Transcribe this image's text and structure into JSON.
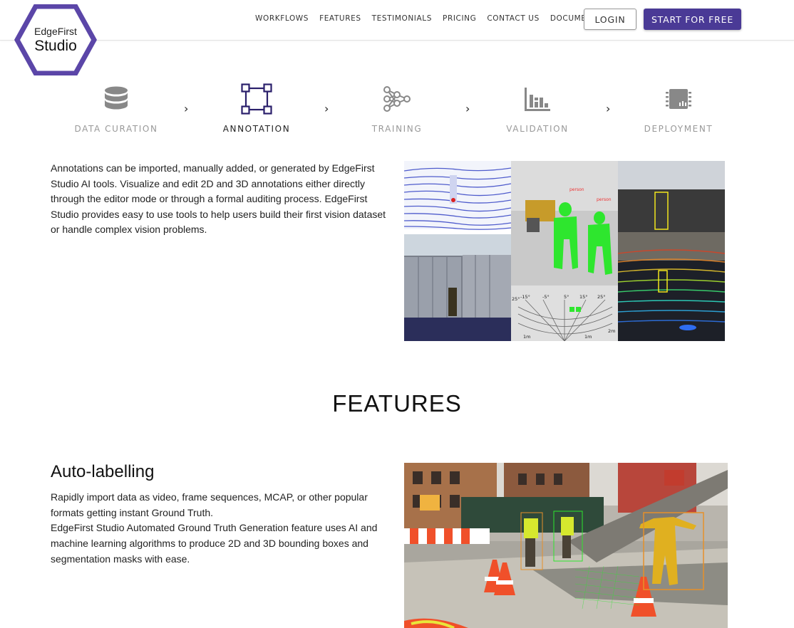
{
  "brand": {
    "logo_line1": "EdgeFirst",
    "logo_line2": "Studio",
    "accent_color": "#4a3a96"
  },
  "nav": {
    "items": [
      "WORKFLOWS",
      "FEATURES",
      "TESTIMONIALS",
      "PRICING",
      "CONTACT US",
      "DOCUMENTATION"
    ],
    "login_label": "LOGIN",
    "start_label": "START FOR FREE"
  },
  "workflow": {
    "steps": [
      {
        "label": "DATA CURATION",
        "icon": "database-icon"
      },
      {
        "label": "ANNOTATION",
        "icon": "bounding-box-icon",
        "active": true
      },
      {
        "label": "TRAINING",
        "icon": "neural-network-icon"
      },
      {
        "label": "VALIDATION",
        "icon": "bar-chart-icon"
      },
      {
        "label": "DEPLOYMENT",
        "icon": "chip-icon"
      }
    ],
    "separator": "›"
  },
  "annotation": {
    "description": "Annotations can be imported, manually added, or generated by EdgeFirst Studio AI tools. Visualize and edit 2D and 3D annotations either directly through the editor mode or through a formal auditing process. EdgeFirst Studio provides easy to use tools to help users build their first vision dataset or handle complex vision problems.",
    "radar_ticks_top": [
      "-15°",
      "-5°",
      "5°",
      "15°",
      "25°"
    ],
    "radar_tick_left": "25°",
    "radar_ticks_bottom": [
      "1m",
      "1m",
      "2m"
    ]
  },
  "features": {
    "title": "FEATURES",
    "auto_labelling": {
      "title": "Auto-labelling",
      "paragraph1": "Rapidly import data as video, frame sequences, MCAP, or other popular formats getting instant Ground Truth.",
      "paragraph2": "EdgeFirst Studio Automated Ground Truth Generation feature uses AI and machine learning algorithms to produce 2D and 3D bounding boxes and segmentation masks with ease."
    }
  }
}
